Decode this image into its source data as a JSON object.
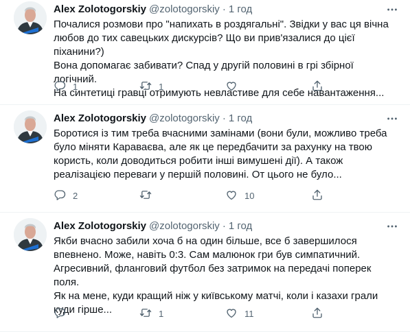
{
  "tweets": [
    {
      "author": "Alex Zolotogorskiy",
      "handle": "@zolotogorskiy",
      "separator": "·",
      "time": "1 год",
      "text": "Почалися розмови про \"напихать в роздягальні\". Звідки у вас ця вічна\nлюбов до тих савецьких дискурсів? Що ви прив'язалися до цієї піханини?)\nВона допомагає забивати? Спад у другій половині в грі збірної логічний.\nНа синтетиці гравці отримують невластиве для себе навантаження...",
      "replies": "1",
      "retweets": "1",
      "likes": "",
      "icons": [
        "more-icon",
        "reply-icon",
        "retweet-icon",
        "like-icon",
        "share-icon"
      ]
    },
    {
      "author": "Alex Zolotogorskiy",
      "handle": "@zolotogorskiy",
      "separator": "·",
      "time": "1 год",
      "text": "Боротися із тим треба вчасними замінами (вони були, можливо треба\nбуло міняти Караваєва, але як це передбачити за рахунку на твою\nкористь, коли доводиться робити інші вимушені дії). А також\nреалізацією переваги у першій половині. От цього не було...",
      "replies": "2",
      "retweets": "",
      "likes": "10",
      "icons": [
        "more-icon",
        "reply-icon",
        "retweet-icon",
        "like-icon",
        "share-icon"
      ]
    },
    {
      "author": "Alex Zolotogorskiy",
      "handle": "@zolotogorskiy",
      "separator": "·",
      "time": "1 год",
      "text": "Якби вчасно забили хоча б на один більше, все б завершилося\nвпевнено. Може, навіть 0:3. Сам малюнок гри був симпатичний.\nАгресивний, фланговий футбол без затримок на передачі поперек поля.\nЯк на мене, куди кращий ніж у київському матчі, коли і казахи грали\nкуди гірше...",
      "replies": "",
      "retweets": "1",
      "likes": "11",
      "icons": [
        "more-icon",
        "reply-icon",
        "retweet-icon",
        "like-icon",
        "share-icon"
      ]
    }
  ],
  "colors": {
    "text": "#0f1419",
    "secondary": "#536471",
    "divider": "#eff3f4",
    "avatar_jacket": "#2f3940"
  }
}
